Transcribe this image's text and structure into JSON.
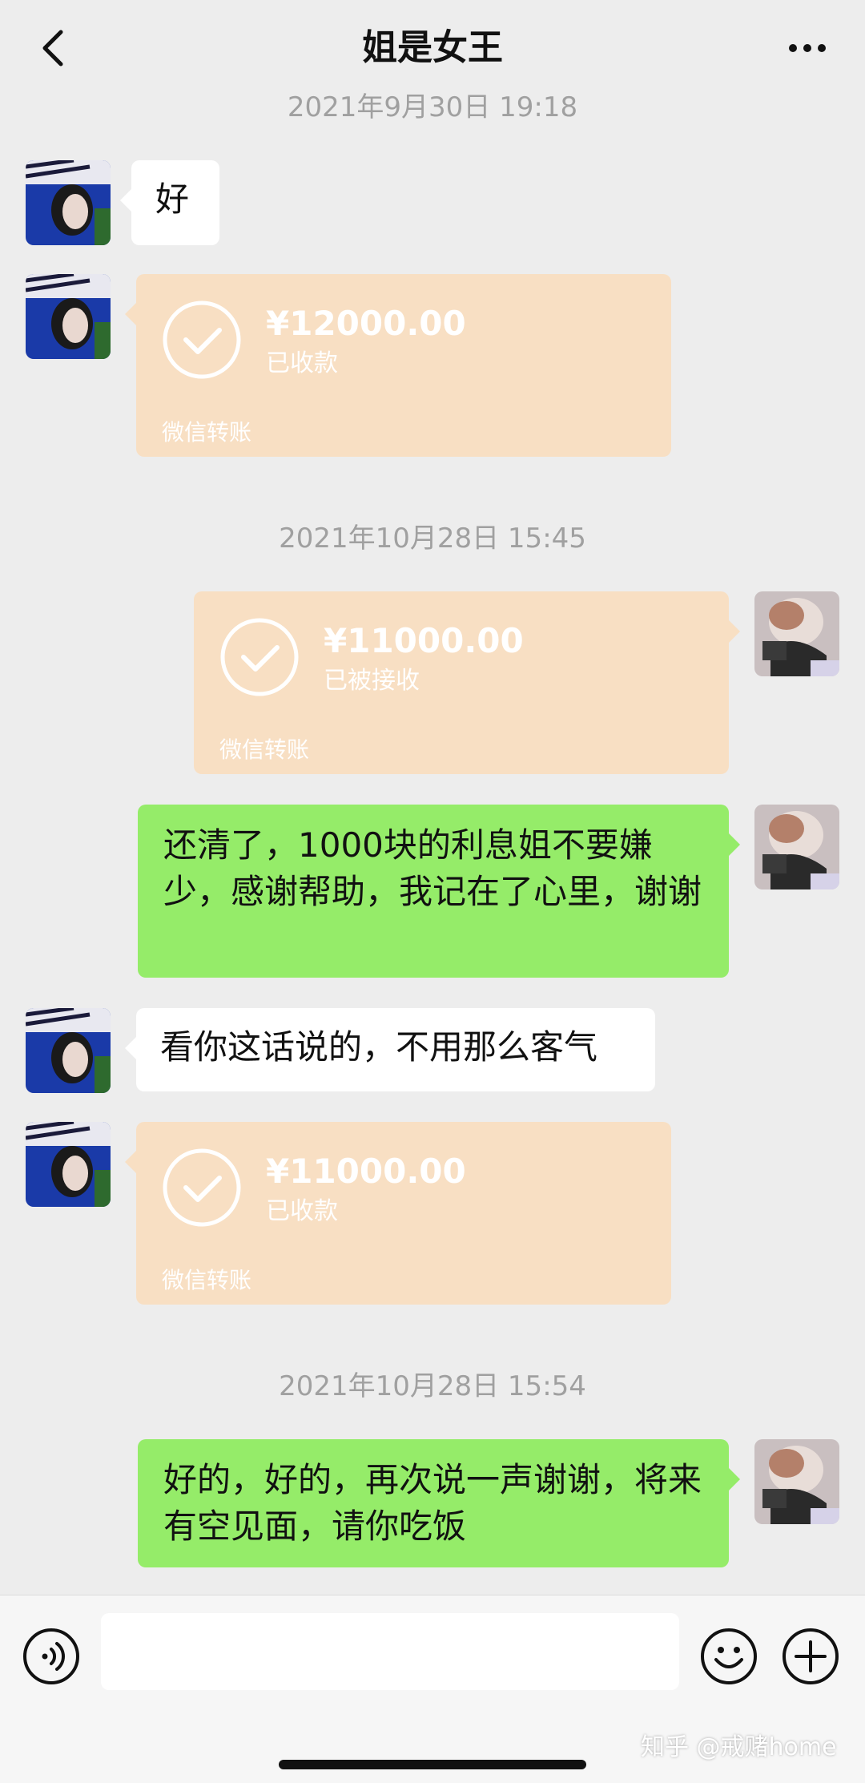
{
  "header": {
    "title": "姐是女王",
    "back_icon": "chevron-left-icon",
    "more_icon": "more-dots-icon"
  },
  "messages": {
    "ts1": "2021年9月30日 19:18",
    "msg1": "好",
    "transfer1": {
      "amount": "¥12000.00",
      "status": "已收款",
      "footer": "微信转账"
    },
    "ts2": "2021年10月28日 15:45",
    "transfer2": {
      "amount": "¥11000.00",
      "status": "已被接收",
      "footer": "微信转账"
    },
    "msg2": "还清了，1000块的利息姐不要嫌少，感谢帮助，我记在了心里，谢谢",
    "msg3": "看你这话说的，不用那么客气",
    "transfer3": {
      "amount": "¥11000.00",
      "status": "已收款",
      "footer": "微信转账"
    },
    "ts3": "2021年10月28日 15:54",
    "msg4": "好的，好的，再次说一声谢谢，将来有空见面，请你吃饭"
  },
  "input_bar": {
    "placeholder": "",
    "voice_icon": "voice-icon",
    "emoji_icon": "emoji-icon",
    "plus_icon": "plus-icon"
  },
  "watermark": "知乎 @戒赌home",
  "colors": {
    "background": "#ededed",
    "green_bubble": "#95ec69",
    "white_bubble": "#ffffff",
    "transfer_card": "#f8dfc3",
    "timestamp_text": "#a0a0a0"
  }
}
